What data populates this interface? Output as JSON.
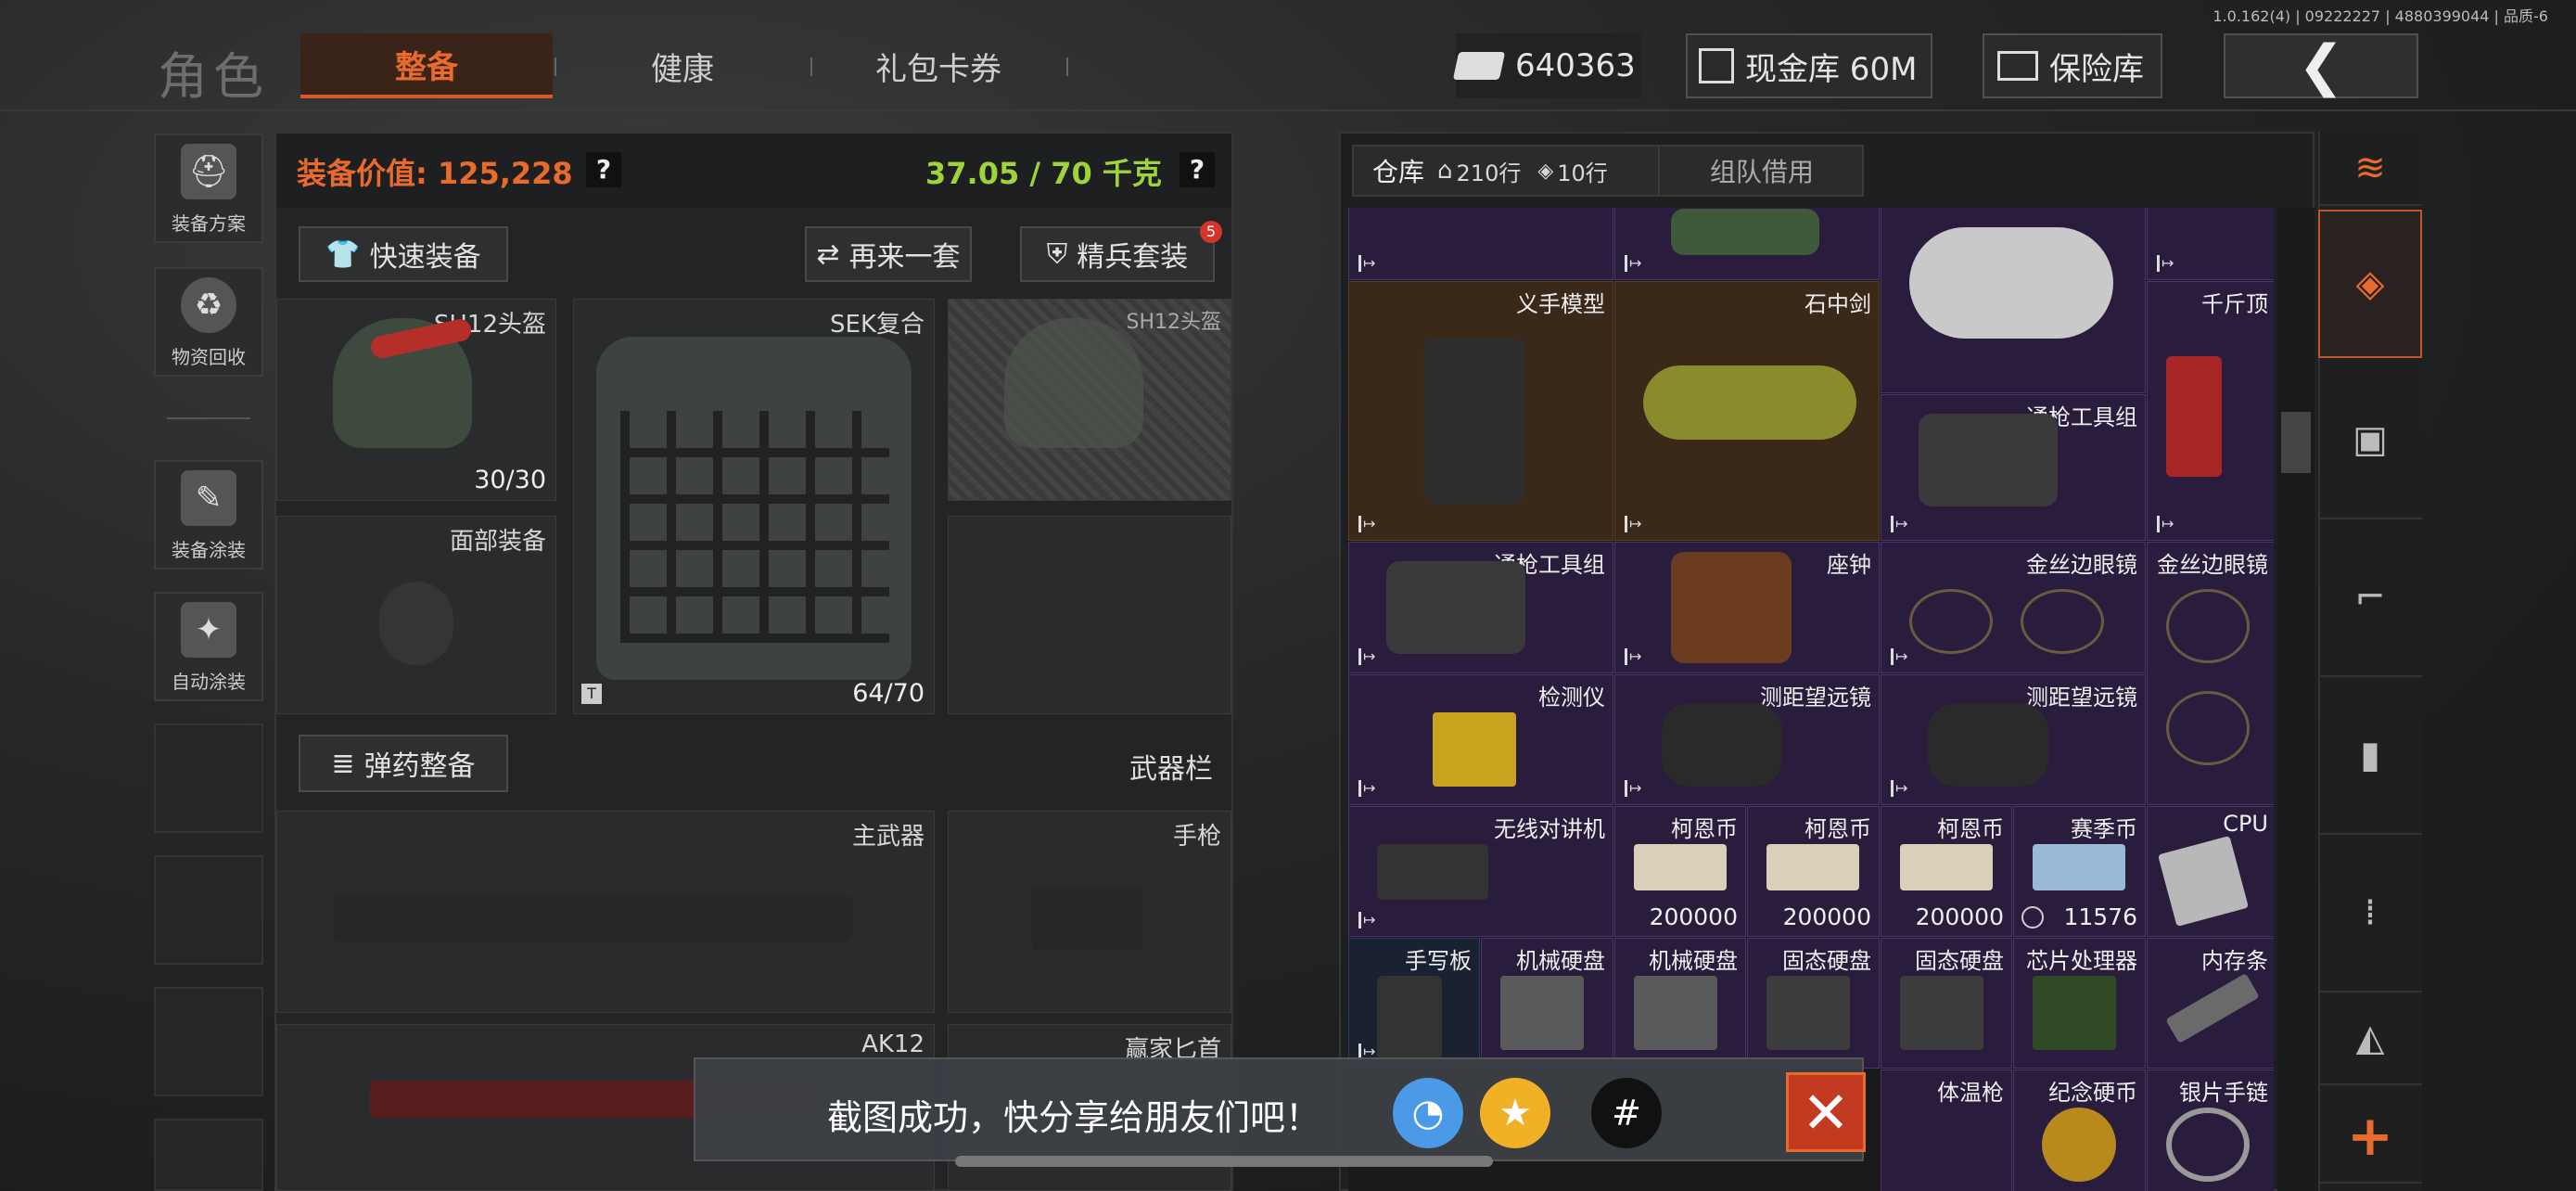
{
  "header": {
    "title": "角色",
    "tabs": [
      {
        "label": "整备"
      },
      {
        "label": "健康"
      },
      {
        "label": "礼包卡券"
      }
    ],
    "currency": "640363",
    "cash_vault": "现金库 60M",
    "safe_box": "保险库",
    "back_icon": "chevron-left-icon",
    "version": "1.0.162(4) | 09222227 | 4880399044 | 品质-6"
  },
  "sidebar": {
    "items": [
      {
        "label": "装备方案",
        "icon": "helmet-plan-icon"
      },
      {
        "label": "物资回收",
        "icon": "recycle-icon"
      },
      {
        "label": "装备涂装",
        "icon": "paint-icon"
      },
      {
        "label": "自动涂装",
        "icon": "auto-paint-icon"
      }
    ]
  },
  "loadout": {
    "value_label": "装备价值: 125,228",
    "weight": "37.05 / 70 千克",
    "help": "?",
    "quick_equip": "快速装备",
    "again": "再来一套",
    "elite": "精兵套装",
    "elite_badge": "5",
    "helmet": {
      "name": "SH12头盔",
      "durability": "30/30"
    },
    "armor": {
      "name": "SEK复合",
      "durability": "64/70",
      "tag": "T"
    },
    "helmet_preview": {
      "name": "SH12头盔"
    },
    "face": {
      "name": "面部装备"
    },
    "ammo": "弹药整备",
    "weapon_bar": "武器栏",
    "primary": "主武器",
    "pistol": "手枪",
    "ak": "AK12",
    "knife": "赢家匕首"
  },
  "warehouse": {
    "tab": "仓库",
    "rows": "210行",
    "tags": "10行",
    "team_borrow": "组队借用",
    "items": {
      "prosthetic": "义手模型",
      "sword": "石中剑",
      "jack": "千斤顶",
      "cleaning_kit": "通枪工具组",
      "cleaning_kit2": "通枪工具组",
      "clock": "座钟",
      "glasses": "金丝边眼镜",
      "glasses2": "金丝边眼镜",
      "detector": "检测仪",
      "rangefinder": "测距望远镜",
      "rangefinder2": "测距望远镜",
      "radio": "无线对讲机",
      "coin1": "柯恩币",
      "coin2": "柯恩币",
      "coin3": "柯恩币",
      "coin_count1": "200000",
      "coin_count2": "200000",
      "coin_count3": "200000",
      "season_coin": "赛季币",
      "season_count": "11576",
      "cpu": "CPU",
      "tablet": "手写板",
      "hdd1": "机械硬盘",
      "hdd2": "机械硬盘",
      "ssd1": "固态硬盘",
      "ssd2": "固态硬盘",
      "chip": "芯片处理器",
      "ram": "内存条",
      "thermo": "体温枪",
      "medal": "纪念硬币",
      "bracelet": "银片手链"
    }
  },
  "toast": {
    "message": "截图成功，快分享给朋友们吧！",
    "close_icon": "close-icon"
  },
  "colors": {
    "accent": "#e86a2c",
    "weight_green": "#9ed33a",
    "purple": "#2a1c3c",
    "brown": "#3a2818"
  }
}
